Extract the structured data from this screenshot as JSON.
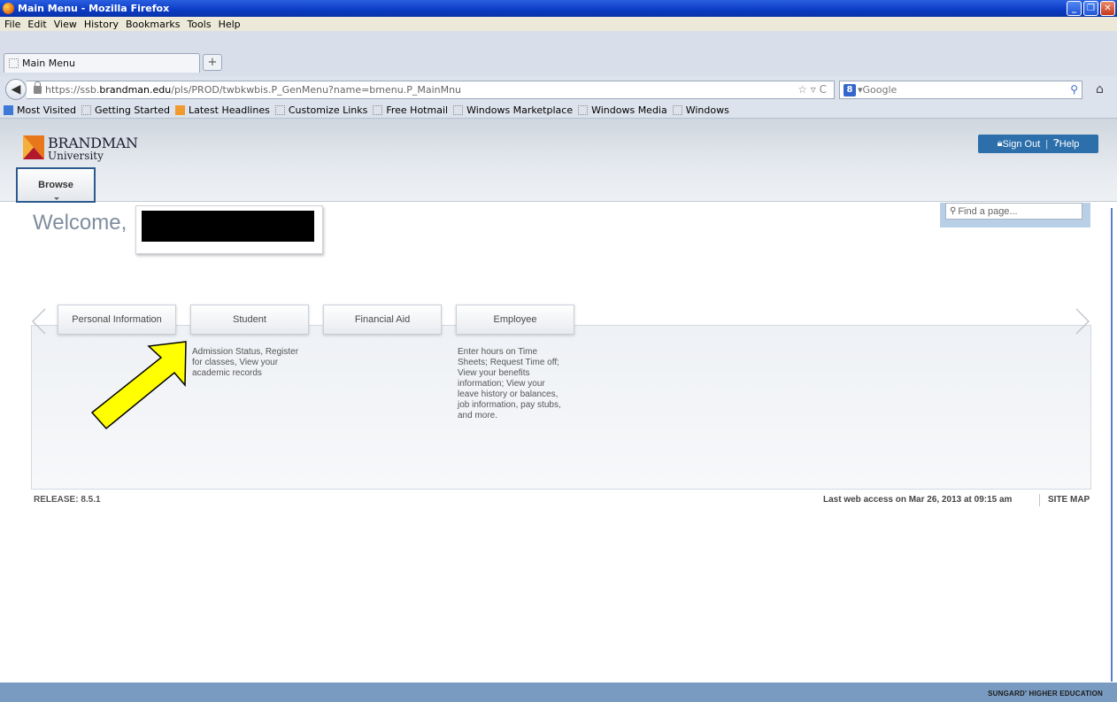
{
  "window": {
    "title": "Main Menu - Mozilla Firefox",
    "controls": {
      "minimize": "_",
      "restore": "❐",
      "close": "✕"
    }
  },
  "menu": [
    "File",
    "Edit",
    "View",
    "History",
    "Bookmarks",
    "Tools",
    "Help"
  ],
  "tab": {
    "label": "Main Menu",
    "new_tab_label": "+"
  },
  "nav": {
    "url_prefix": "https://ssb.",
    "url_host": "brandman.edu",
    "url_path": "/pls/PROD/twbkwbis.P_GenMenu?name=bmenu.P_MainMnu",
    "url_right": "☆ ▿ C",
    "search_placeholder": "Google"
  },
  "bookmarks": [
    "Most Visited",
    "Getting Started",
    "Latest Headlines",
    "Customize Links",
    "Free Hotmail",
    "Windows Marketplace",
    "Windows Media",
    "Windows"
  ],
  "header": {
    "logo_title": "BRANDMAN",
    "logo_subtitle": "University",
    "sign_out": "Sign Out",
    "help": "Help",
    "browse": "Browse"
  },
  "welcome": {
    "text": "Welcome,"
  },
  "find": {
    "placeholder": "Find a page..."
  },
  "menu_tabs": [
    {
      "label": "Personal Information",
      "description": ""
    },
    {
      "label": "Student",
      "description": "Admission Status, Register for classes, View your academic records"
    },
    {
      "label": "Financial Aid",
      "description": ""
    },
    {
      "label": "Employee",
      "description": "Enter hours on Time Sheets; Request Time off; View your benefits information; View your leave history or balances, job information, pay stubs, and more."
    }
  ],
  "student_desc_lines": [
    "Admission Status, Register",
    "for classes, View your",
    "academic records"
  ],
  "employee_desc_lines": [
    "Enter hours on Time",
    "Sheets; Request Time off;",
    "View your benefits",
    "information; View your",
    "leave history or balances,",
    "job information, pay stubs,",
    "and more."
  ],
  "footer": {
    "release": "RELEASE: 8.5.1",
    "last_access": "Last web access on Mar 26, 2013 at 09:15 am",
    "site_map": "SITE MAP",
    "vendor": "SUNGARD' HIGHER EDUCATION"
  },
  "colors": {
    "title_bar": "#0b3bc4",
    "accent_blue": "#2c6fab",
    "logo_orange": "#e8761a",
    "logo_red": "#b2182b",
    "annotation_yellow": "#ffff00"
  }
}
